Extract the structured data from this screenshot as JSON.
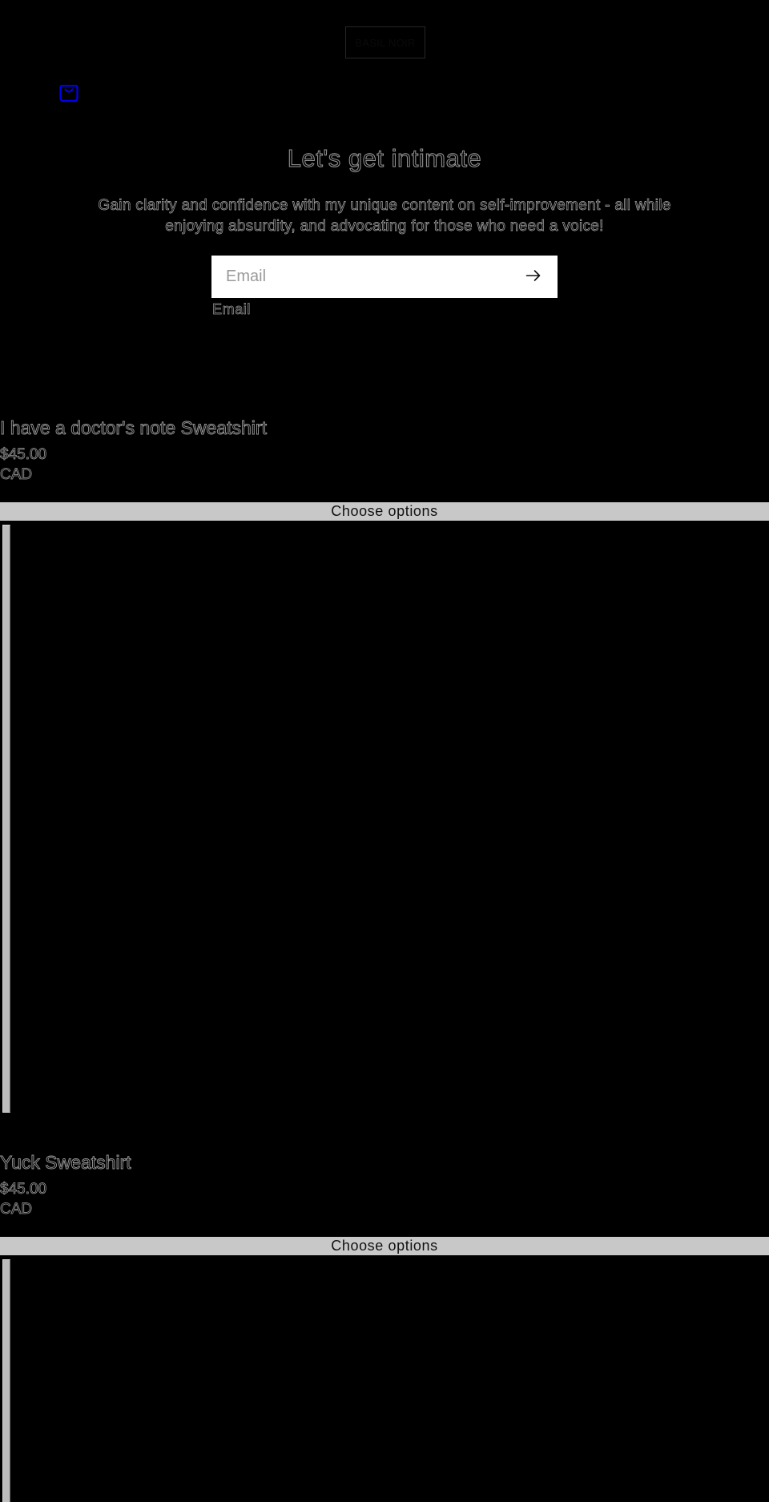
{
  "header": {
    "logo_text": "BASIL NOIR",
    "cart_icon": "shopping-bag-icon",
    "accent_color": "#0000ee"
  },
  "newsletter": {
    "title": "Let's get intimate",
    "description": "Gain clarity and confidence with my unique content on self-improvement - all while enjoying absurdity, and advocating for those who need a voice!",
    "email_placeholder": "Email",
    "email_label": "Email",
    "submit_icon": "arrow-right-icon"
  },
  "products": [
    {
      "title": "I have a doctor's note Sweatshirt",
      "price": "$45.00 CAD",
      "button_label": "Choose options"
    },
    {
      "title": "Yuck Sweatshirt",
      "price": "$45.00 CAD",
      "button_label": "Choose options"
    }
  ],
  "colors": {
    "background": "#000000",
    "button_bg": "#c8c8c8",
    "input_bg": "#ffffff"
  }
}
